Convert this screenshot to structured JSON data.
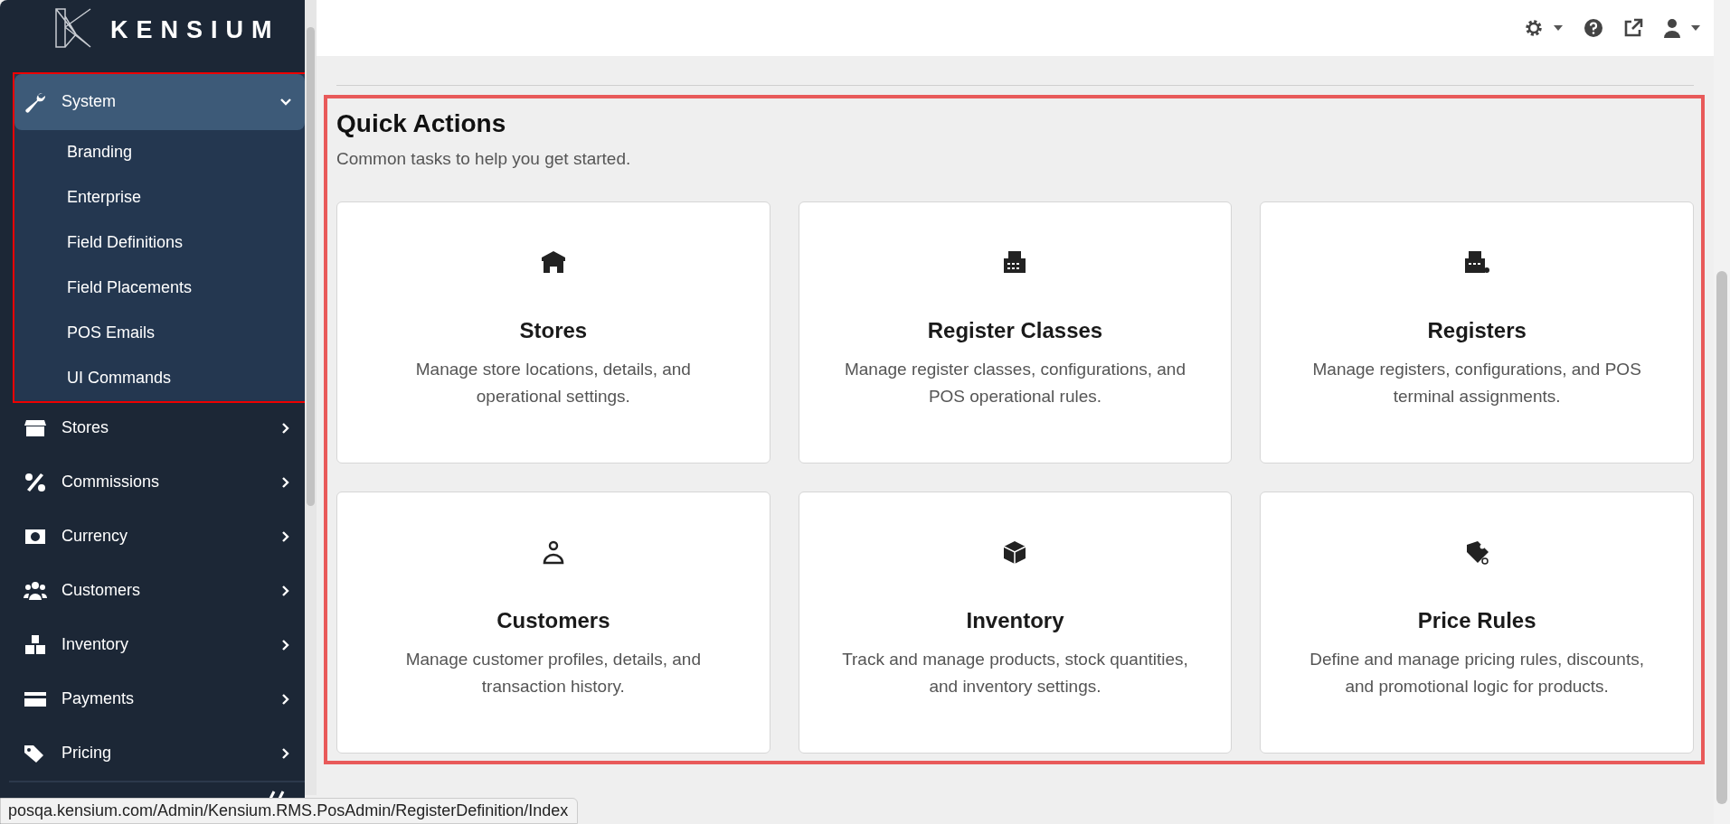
{
  "logo": {
    "text": "KENSIUM"
  },
  "sidebar": {
    "items": [
      {
        "label": "System",
        "expanded": true,
        "selected": true,
        "children": [
          {
            "label": "Branding"
          },
          {
            "label": "Enterprise"
          },
          {
            "label": "Field Definitions"
          },
          {
            "label": "Field Placements"
          },
          {
            "label": "POS Emails"
          },
          {
            "label": "UI Commands"
          }
        ]
      },
      {
        "label": "Stores",
        "expanded": false,
        "selected": false
      },
      {
        "label": "Commissions",
        "expanded": false,
        "selected": false
      },
      {
        "label": "Currency",
        "expanded": false,
        "selected": false
      },
      {
        "label": "Customers",
        "expanded": false,
        "selected": false
      },
      {
        "label": "Inventory",
        "expanded": false,
        "selected": false
      },
      {
        "label": "Payments",
        "expanded": false,
        "selected": false
      },
      {
        "label": "Pricing",
        "expanded": false,
        "selected": false
      }
    ]
  },
  "quick_actions": {
    "title": "Quick Actions",
    "subtitle": "Common tasks to help you get started.",
    "cards": [
      {
        "title": "Stores",
        "description": "Manage store locations, details, and operational settings."
      },
      {
        "title": "Register Classes",
        "description": "Manage register classes, configurations, and POS operational rules."
      },
      {
        "title": "Registers",
        "description": "Manage registers, configurations, and POS terminal assignments."
      },
      {
        "title": "Customers",
        "description": "Manage customer profiles, details, and transaction history."
      },
      {
        "title": "Inventory",
        "description": "Track and manage products, stock quantities, and inventory settings."
      },
      {
        "title": "Price Rules",
        "description": "Define and manage pricing rules, discounts, and promotional logic for products."
      }
    ]
  },
  "status_bar": {
    "url": "posqa.kensium.com/Admin/Kensium.RMS.PosAdmin/RegisterDefinition/Index"
  }
}
